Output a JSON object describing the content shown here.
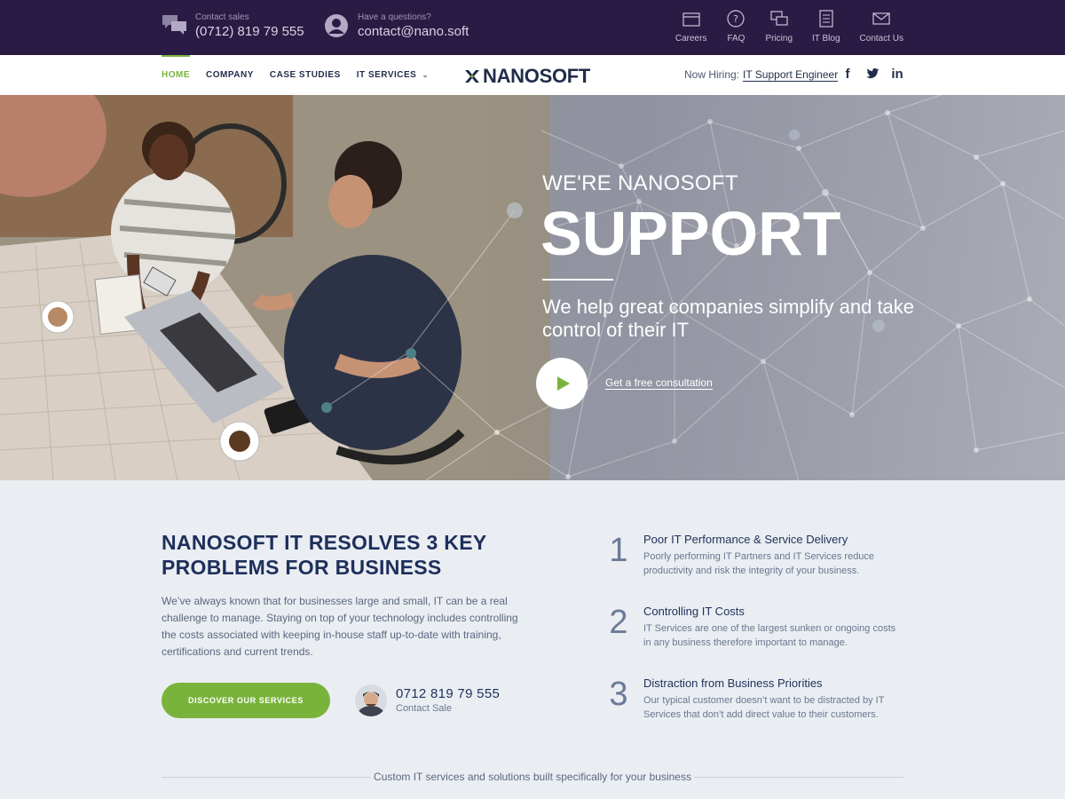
{
  "topbar": {
    "sales_label": "Contact sales",
    "sales_phone": "(0712) 819 79 555",
    "help_label": "Have a questions?",
    "help_email": "contact@nano.soft",
    "links": [
      {
        "label": "Careers",
        "icon": "briefcase-icon"
      },
      {
        "label": "FAQ",
        "icon": "question-icon"
      },
      {
        "label": "Pricing",
        "icon": "pricing-icon"
      },
      {
        "label": "IT Blog",
        "icon": "blog-icon"
      },
      {
        "label": "Contact Us",
        "icon": "envelope-icon"
      }
    ]
  },
  "nav": {
    "items": [
      {
        "label": "HOME",
        "active": true
      },
      {
        "label": "COMPANY"
      },
      {
        "label": "CASE STUDIES"
      },
      {
        "label": "IT SERVICES",
        "dropdown": true
      }
    ],
    "logo": "NANOSOFT",
    "hiring_label": "Now Hiring:",
    "hiring_link": "IT Support Engineer",
    "social": [
      "f",
      "t",
      "in"
    ]
  },
  "hero": {
    "pretitle": "WE'RE NANOSOFT",
    "title": "SUPPORT",
    "subtitle": "We help great companies simplify and take control of their IT",
    "cta": "Get a free consultation"
  },
  "content": {
    "title": "NANOSOFT IT RESOLVES 3 KEY PROBLEMS FOR BUSINESS",
    "body": "We’ve always known that for businesses large and small, IT can be a real challenge to manage. Staying on top of your technology includes controlling the costs associated with keeping in-house staff up-to-date with training, certifications and current trends.",
    "button": "DISCOVER OUR SERVICES",
    "contact_phone": "0712 819 79 555",
    "contact_label": "Contact Sale",
    "problems": [
      {
        "num": "1",
        "title": "Poor IT Performance & Service Delivery",
        "desc": "Poorly performing IT Partners and IT Services reduce productivity and risk the integrity of your business."
      },
      {
        "num": "2",
        "title": "Controlling IT Costs",
        "desc": "IT Services are one of the largest sunken or ongoing costs in any business therefore important to manage."
      },
      {
        "num": "3",
        "title": "Distraction from Business Priorities",
        "desc": "Our typical customer doesn’t want to be distracted by IT Services that don’t add direct value to their customers."
      }
    ],
    "divider": "Custom IT services and solutions built specifically for your business"
  },
  "colors": {
    "topbar": "#2a1b44",
    "accent": "#7ab33c",
    "navy": "#1e2f5b"
  }
}
